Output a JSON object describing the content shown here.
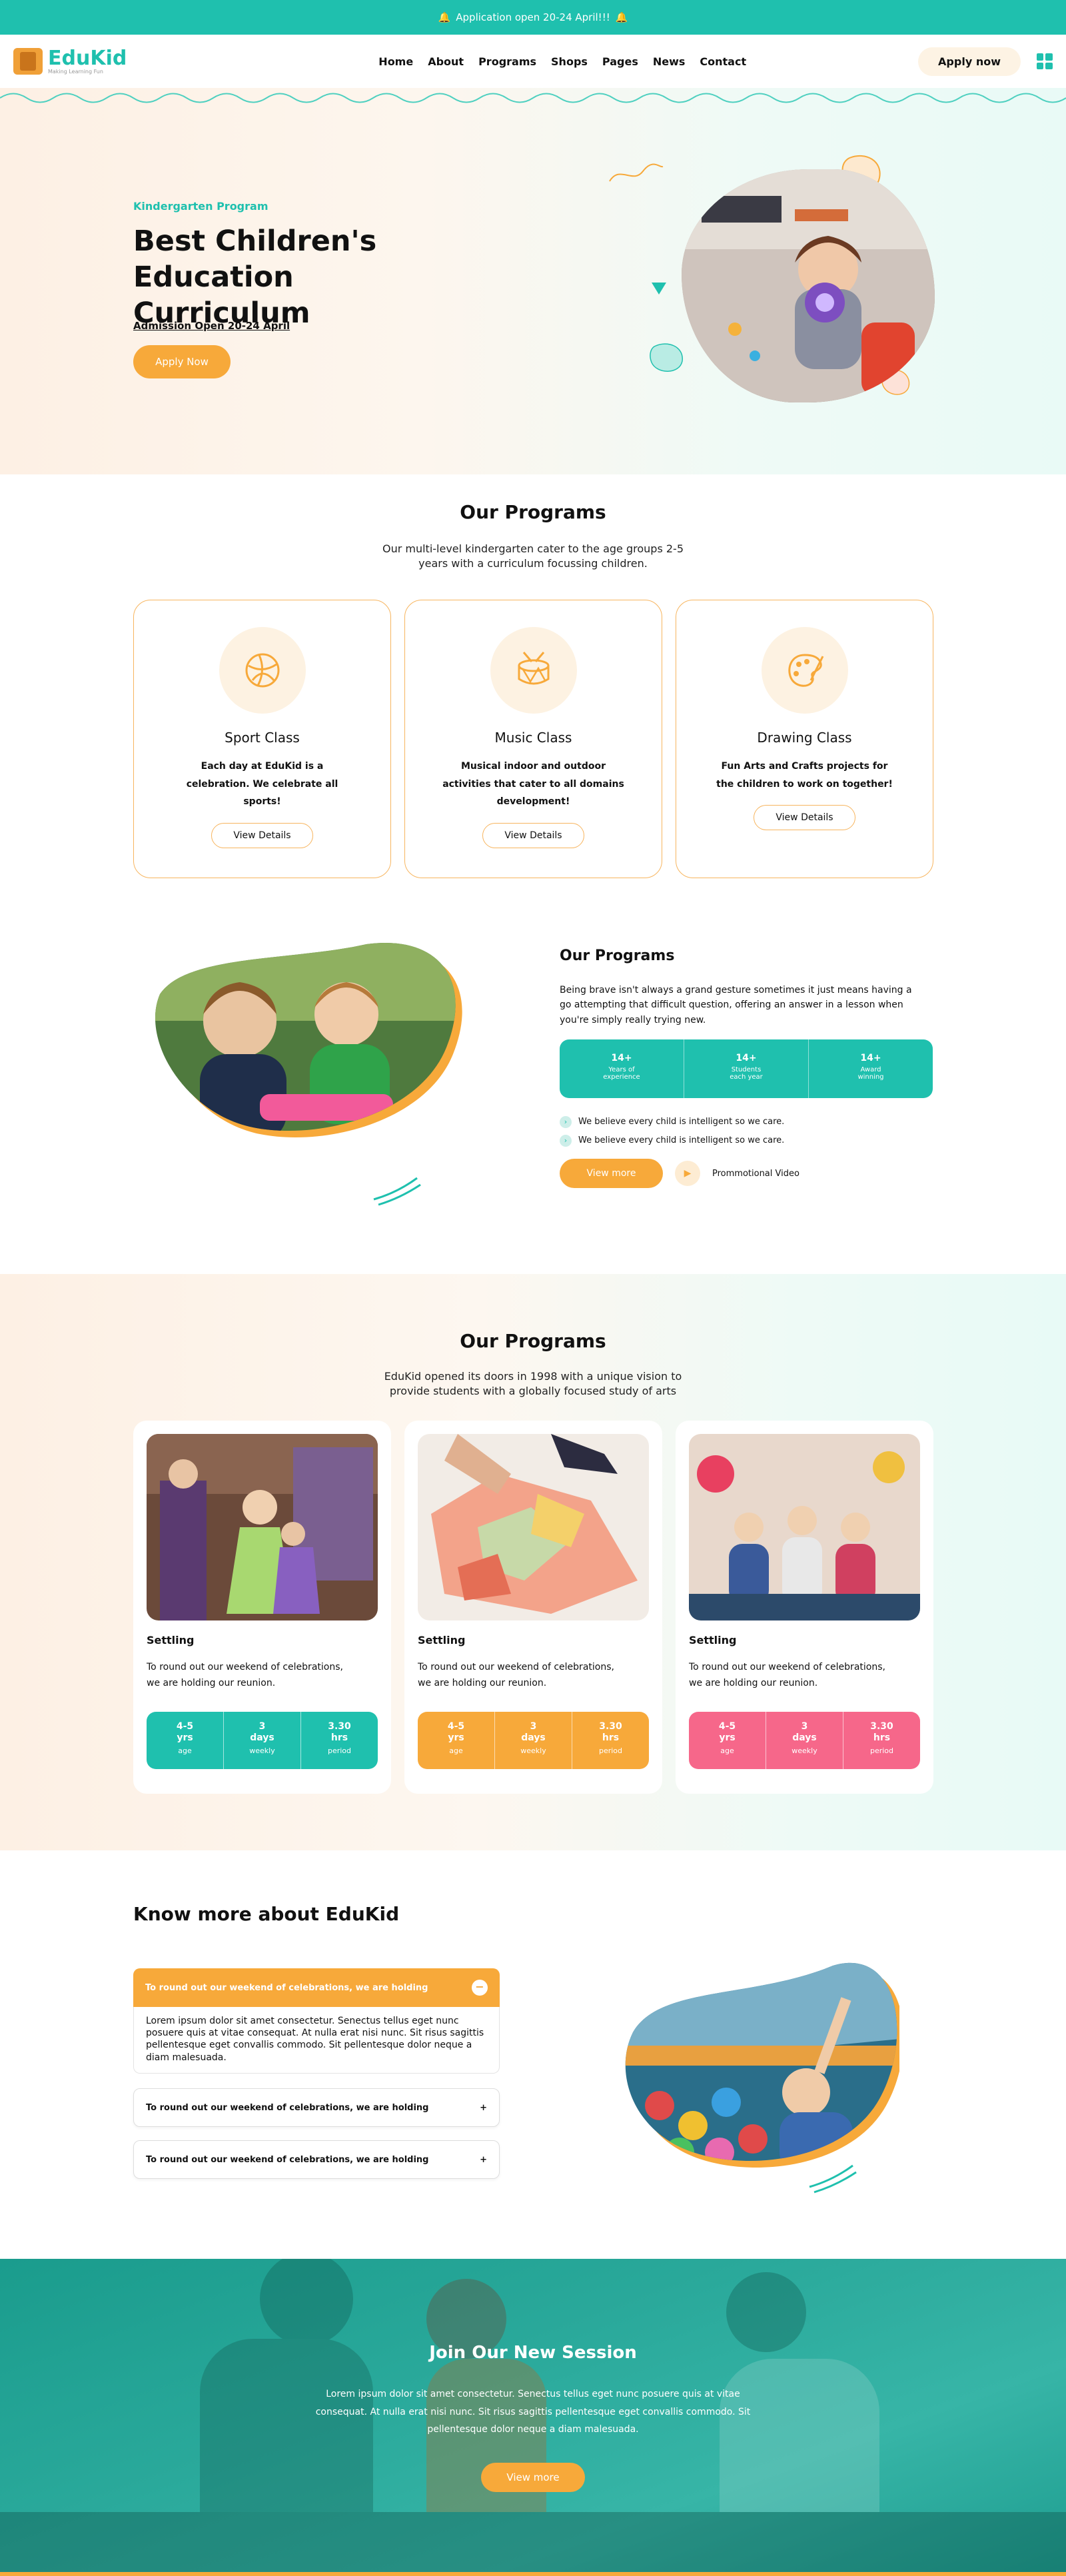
{
  "topbar": {
    "icon": "bell-icon",
    "text": "Application open 20-24 April!!!"
  },
  "brand": {
    "name": "EduKid",
    "tagline": "Making Learning Fun"
  },
  "nav": {
    "items": [
      "Home",
      "About",
      "Programs",
      "Shops",
      "Pages",
      "News",
      "Contact"
    ],
    "cta": "Apply now",
    "menu_icon": "grid-icon"
  },
  "hero": {
    "eyebrow": "Kindergarten Program",
    "title": "Best Children's Education Curriculum",
    "admission": "Admission Open 20-24 April",
    "button": "Apply Now"
  },
  "programs": {
    "title": "Our Programs",
    "subtitle": "Our multi-level kindergarten cater to the age groups 2-5 years with a curriculum focussing children.",
    "cards": [
      {
        "icon": "ball-icon",
        "title": "Sport Class",
        "desc": "Each day at EduKid is a celebration. We celebrate all sports!",
        "button": "View Details"
      },
      {
        "icon": "drum-icon",
        "title": "Music Class",
        "desc": "Musical indoor and outdoor activities that cater to all domains development!",
        "button": "View Details"
      },
      {
        "icon": "palette-icon",
        "title": "Drawing Class",
        "desc": "Fun Arts and Crafts projects for the children to work on together!",
        "button": "View Details"
      }
    ]
  },
  "about": {
    "title": "Our Programs",
    "text": "Being brave isn't always a grand gesture sometimes it just means having a go attempting that difficult question, offering an answer in a lesson when you're simply really trying new.",
    "stats": [
      {
        "value": "14+",
        "label": "Years of experience"
      },
      {
        "value": "14+",
        "label": "Students each year"
      },
      {
        "value": "14+",
        "label": "Award winning"
      }
    ],
    "checks": [
      "We believe every child is intelligent so we care.",
      "We believe every child is intelligent so we care."
    ],
    "button": "View more",
    "video": "Prommotional Video"
  },
  "programs2": {
    "title": "Our Programs",
    "subtitle": "EduKid opened its doors in 1998 with a unique vision to provide students with a globally focused study of arts",
    "cards": [
      {
        "title": "Settling",
        "desc": "To round out our weekend of celebrations, we are holding our reunion.",
        "color": "#1fc0ae",
        "stats": [
          {
            "v": "4-5 yrs",
            "l": "age"
          },
          {
            "v": "3 days",
            "l": "weekly"
          },
          {
            "v": "3.30 hrs",
            "l": "period"
          }
        ]
      },
      {
        "title": "Settling",
        "desc": "To round out our weekend of celebrations, we are holding our reunion.",
        "color": "#f7a93a",
        "stats": [
          {
            "v": "4-5 yrs",
            "l": "age"
          },
          {
            "v": "3 days",
            "l": "weekly"
          },
          {
            "v": "3.30 hrs",
            "l": "period"
          }
        ]
      },
      {
        "title": "Settling",
        "desc": "To round out our weekend of celebrations, we are holding our reunion.",
        "color": "#f6678a",
        "stats": [
          {
            "v": "4-5 yrs",
            "l": "age"
          },
          {
            "v": "3 days",
            "l": "weekly"
          },
          {
            "v": "3.30 hrs",
            "l": "period"
          }
        ]
      }
    ]
  },
  "faq": {
    "title": "Know more about EduKid",
    "items": [
      {
        "q": "To round out our weekend of celebrations, we are holding",
        "a": "Lorem ipsum dolor sit amet consectetur. Senectus tellus eget nunc posuere quis at vitae consequat. At nulla erat nisi nunc. Sit risus sagittis pellentesque eget convallis commodo. Sit pellentesque dolor neque a diam malesuada.",
        "open": true
      },
      {
        "q": "To round out our weekend of celebrations, we are holding",
        "open": false
      },
      {
        "q": "To round out our weekend of celebrations, we are holding",
        "open": false
      }
    ]
  },
  "cta": {
    "title": "Join Our New Session",
    "text": "Lorem ipsum dolor sit amet consectetur. Senectus tellus eget nunc posuere quis at vitae consequat. At nulla erat nisi nunc. Sit risus sagittis pellentesque eget convallis commodo. Sit pellentesque dolor neque a diam malesuada.",
    "button": "View more"
  }
}
